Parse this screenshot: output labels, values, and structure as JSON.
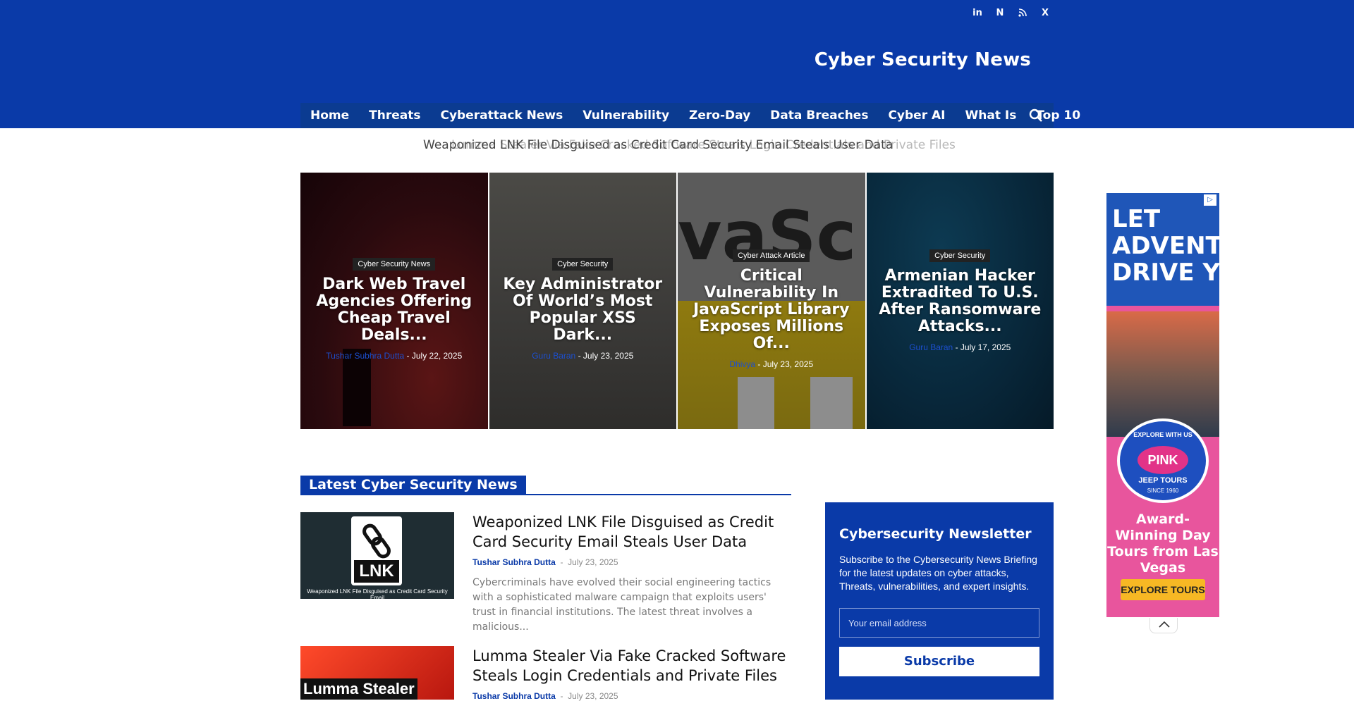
{
  "header": {
    "site_title": "Cyber Security News",
    "social": [
      "in",
      "N",
      "rss",
      "X"
    ]
  },
  "nav": {
    "items": [
      "Home",
      "Threats",
      "Cyberattack News",
      "Vulnerability",
      "Zero-Day",
      "Data Breaches",
      "Cyber AI",
      "What Is",
      "Top 10"
    ]
  },
  "ticker": {
    "primary": "Weaponized LNK File Disguised as Credit Card Security Email Steals User Data",
    "secondary": "Lumma Stealer Via Fake Cracked Software Steals Login Credentials and Private Files"
  },
  "featured": [
    {
      "category": "Cyber Security News",
      "title": "Dark Web Travel Agencies Offering Cheap Travel Deals...",
      "author": "Tushar Subhra Dutta",
      "date": "July 22, 2025"
    },
    {
      "category": "Cyber Security",
      "title": "Key Administrator Of World’s Most Popular XSS Dark...",
      "author": "Guru Baran",
      "date": "July 23, 2025"
    },
    {
      "category": "Cyber Attack Article",
      "title": "Critical Vulnerability In JavaScript Library Exposes Millions Of...",
      "author": "Dhivya",
      "date": "July 23, 2025"
    },
    {
      "category": "Cyber Security",
      "title": "Armenian Hacker Extradited To U.S. After Ransomware Attacks...",
      "author": "Guru Baran",
      "date": "July 17, 2025"
    }
  ],
  "section": {
    "title": "Latest Cyber Security News"
  },
  "articles": [
    {
      "title": "Weaponized LNK File Disguised as Credit Card Security Email Steals User Data",
      "author": "Tushar Subhra Dutta",
      "date": "July 23, 2025",
      "excerpt": "Cybercriminals have evolved their social engineering tactics with a sophisticated malware campaign that exploits users' trust in financial institutions. The latest threat involves a malicious...",
      "thumb_label": "LNK",
      "thumb_caption": "Weaponized LNK File Disguised as Credit Card Security Email"
    },
    {
      "title": "Lumma Stealer Via Fake Cracked Software Steals Login Credentials and Private Files",
      "author": "Tushar Subhra Dutta",
      "date": "July 23, 2025",
      "thumb_label": "Lumma Stealer"
    }
  ],
  "newsletter": {
    "title": "Cybersecurity Newsletter",
    "desc": "Subscribe to the Cybersecurity News Briefing for the latest updates on cyber attacks, Threats, vulnerabilities, and expert insights.",
    "email_placeholder": "Your email address",
    "button": "Subscribe"
  },
  "ad": {
    "headline": "LET ADVENTURE DRIVE YOU",
    "badge_top": "EXPLORE WITH US",
    "badge_brand": "PINK",
    "badge_sub": "JEEP TOURS",
    "badge_since": "SINCE 1960",
    "tagline": "Award-Winning Day Tours from Las Vegas",
    "cta": "EXPLORE TOURS"
  },
  "colors": {
    "brand": "#0a3aa8",
    "nav": "#0b3b91"
  }
}
